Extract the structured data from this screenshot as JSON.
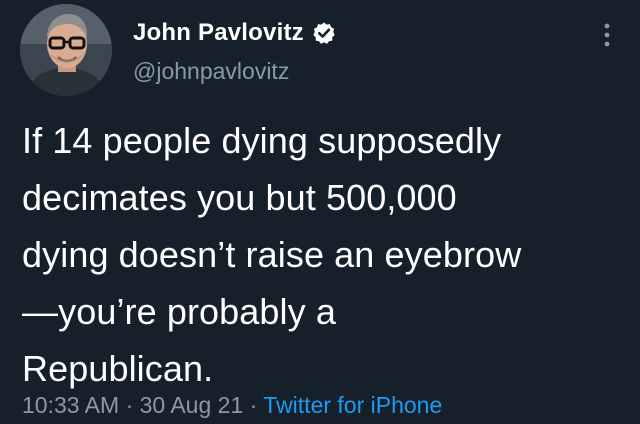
{
  "user": {
    "display_name": "John Pavlovitz",
    "handle": "@johnpavlovitz"
  },
  "tweet": {
    "text": "If 14 people dying supposedly\ndecimates you but 500,000\ndying doesn’t raise an eyebrow\n—you’re probably a\nRepublican.",
    "time": "10:33 AM",
    "separator": "·",
    "date": "30 Aug 21",
    "source": "Twitter for iPhone"
  },
  "icons": {
    "verified": "verified-badge-icon",
    "more": "more-options-icon"
  },
  "colors": {
    "background": "#15202b",
    "text": "#ffffff",
    "muted": "#8b98a5",
    "link": "#1d9bf0"
  }
}
